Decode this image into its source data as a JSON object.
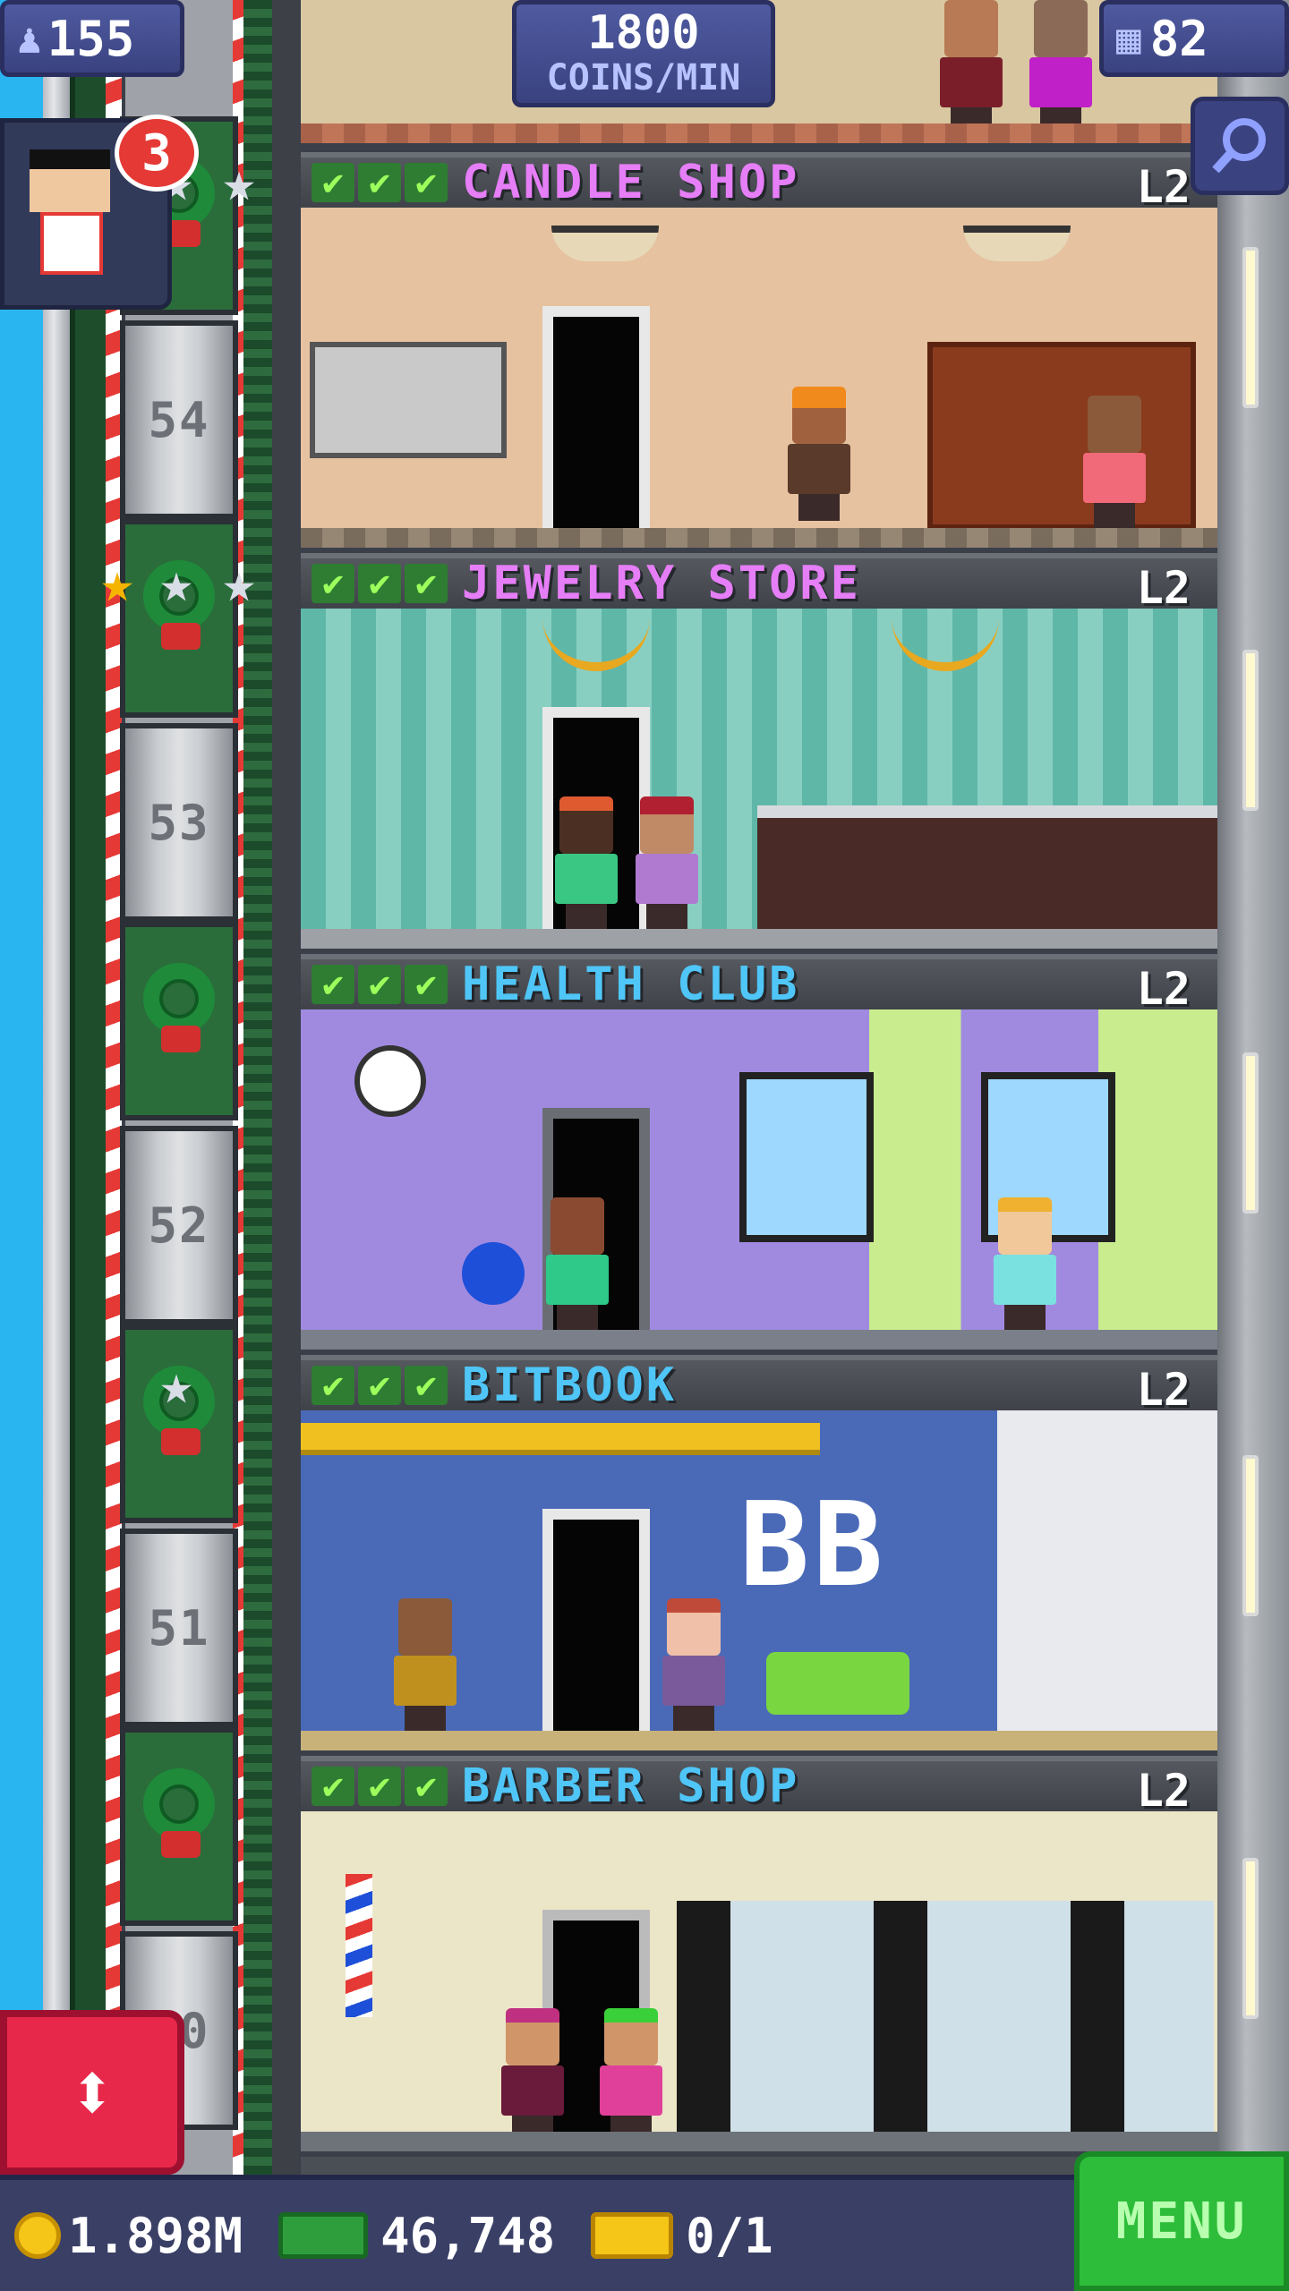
{
  "hud": {
    "population": "155",
    "coins_per_min_value": "1800",
    "coins_per_min_unit": "COINS/MIN",
    "floor_count": "82"
  },
  "vip": {
    "badge_count": "3"
  },
  "shaft_floors": [
    "54",
    "53",
    "52",
    "51",
    "50"
  ],
  "floors": [
    {
      "name": "CANDLE SHOP",
      "level": "L2",
      "color": "#e67ef7"
    },
    {
      "name": "JEWELRY STORE",
      "level": "L2",
      "color": "#e67ef7"
    },
    {
      "name": "HEALTH CLUB",
      "level": "L2",
      "color": "#4fc6f7"
    },
    {
      "name": "BITBOOK",
      "level": "L2",
      "color": "#4fc6f7"
    },
    {
      "name": "BARBER SHOP",
      "level": "L2",
      "color": "#4fc6f7"
    }
  ],
  "bottom_bar": {
    "coins": "1.898M",
    "bux": "46,748",
    "tickets": "0/1",
    "menu_label": "MENU"
  },
  "icons": {
    "check": "✔",
    "elevator": "⬍",
    "search": "magnifier-icon"
  }
}
